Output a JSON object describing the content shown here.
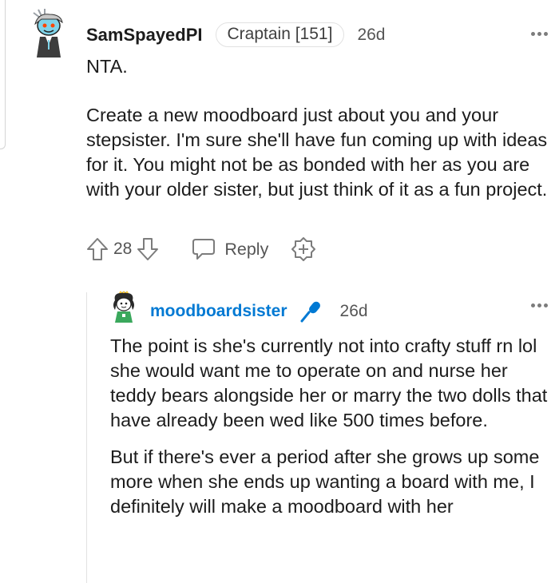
{
  "comments": [
    {
      "username": "SamSpayedPI",
      "flair": "Craptain [151]",
      "time": "26d",
      "paragraphs": [
        "NTA.",
        "Create a new moodboard just about you and your stepsister. I'm sure she'll have fun coming up with ideas for it. You might not be as bonded with her as you are with your older sister, but just think of it as a fun project."
      ],
      "votes": "28",
      "reply_label": "Reply"
    },
    {
      "username": "moodboardsister",
      "time": "26d",
      "paragraphs": [
        "The point is she's currently not into crafty stuff rn lol she would want me to operate on and nurse her teddy bears alongside her or marry the two dolls that have already been wed like 500 times before.",
        "But if there's ever a period after she grows up some more when she ends up wanting a board with me, I definitely will make a moodboard with her"
      ]
    }
  ],
  "icons": {
    "upvote": "upvote-arrow-icon",
    "downvote": "downvote-arrow-icon",
    "reply": "speech-bubble-icon",
    "award": "award-plus-icon",
    "more": "more-dots-icon",
    "op": "microphone-icon"
  },
  "colors": {
    "op_username": "#0079d3",
    "op_badge": "#0079d3"
  }
}
